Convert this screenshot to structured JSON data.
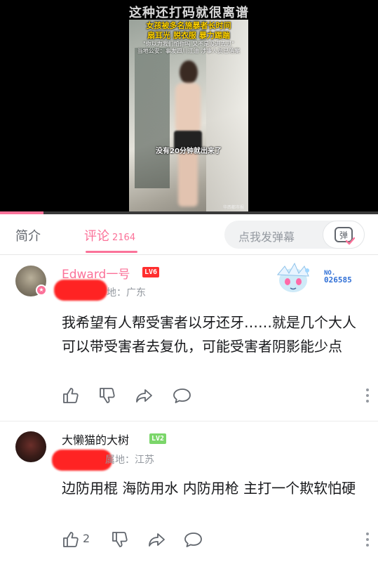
{
  "video": {
    "top_caption": "这种还打码就很离谱",
    "overlay_line1": "女孩被多名施暴者长时间",
    "overlay_line2": "扇耳光 脱衣服 暴力踢踹",
    "overlay_line3": "\"你以为我们怕你吗 又不是没进去过\"",
    "overlay_line4": "当地公安：事发四川江油 涉事人员已落案",
    "subtitle": "没有20分钟就出来了",
    "watermark": "华西都市报",
    "progress": 0.115
  },
  "tabs": {
    "intro": "简介",
    "comments": "评论",
    "comment_count": "2164",
    "danmaku_placeholder": "点我发弹幕",
    "danmaku_icon_label": "弹"
  },
  "comments": [
    {
      "username": "Edward一号",
      "level": "LV6",
      "location_label": "地：广东",
      "badge_no_label": "NO.",
      "badge_no": "026585",
      "text": "我希望有人帮受害者以牙还牙……就是几个大人可以带受害者去复仇，可能受害者阴影能少点",
      "likes": ""
    },
    {
      "username": "大懒猫的大树",
      "level": "LV2",
      "location_label": "属地：江苏",
      "text": "边防用棍 海防用水 内防用枪 主打一个欺软怕硬",
      "likes": "2"
    }
  ],
  "colors": {
    "accent": "#fb7299",
    "lv6": "#ff2e2e",
    "lv2": "#7bd66a"
  }
}
